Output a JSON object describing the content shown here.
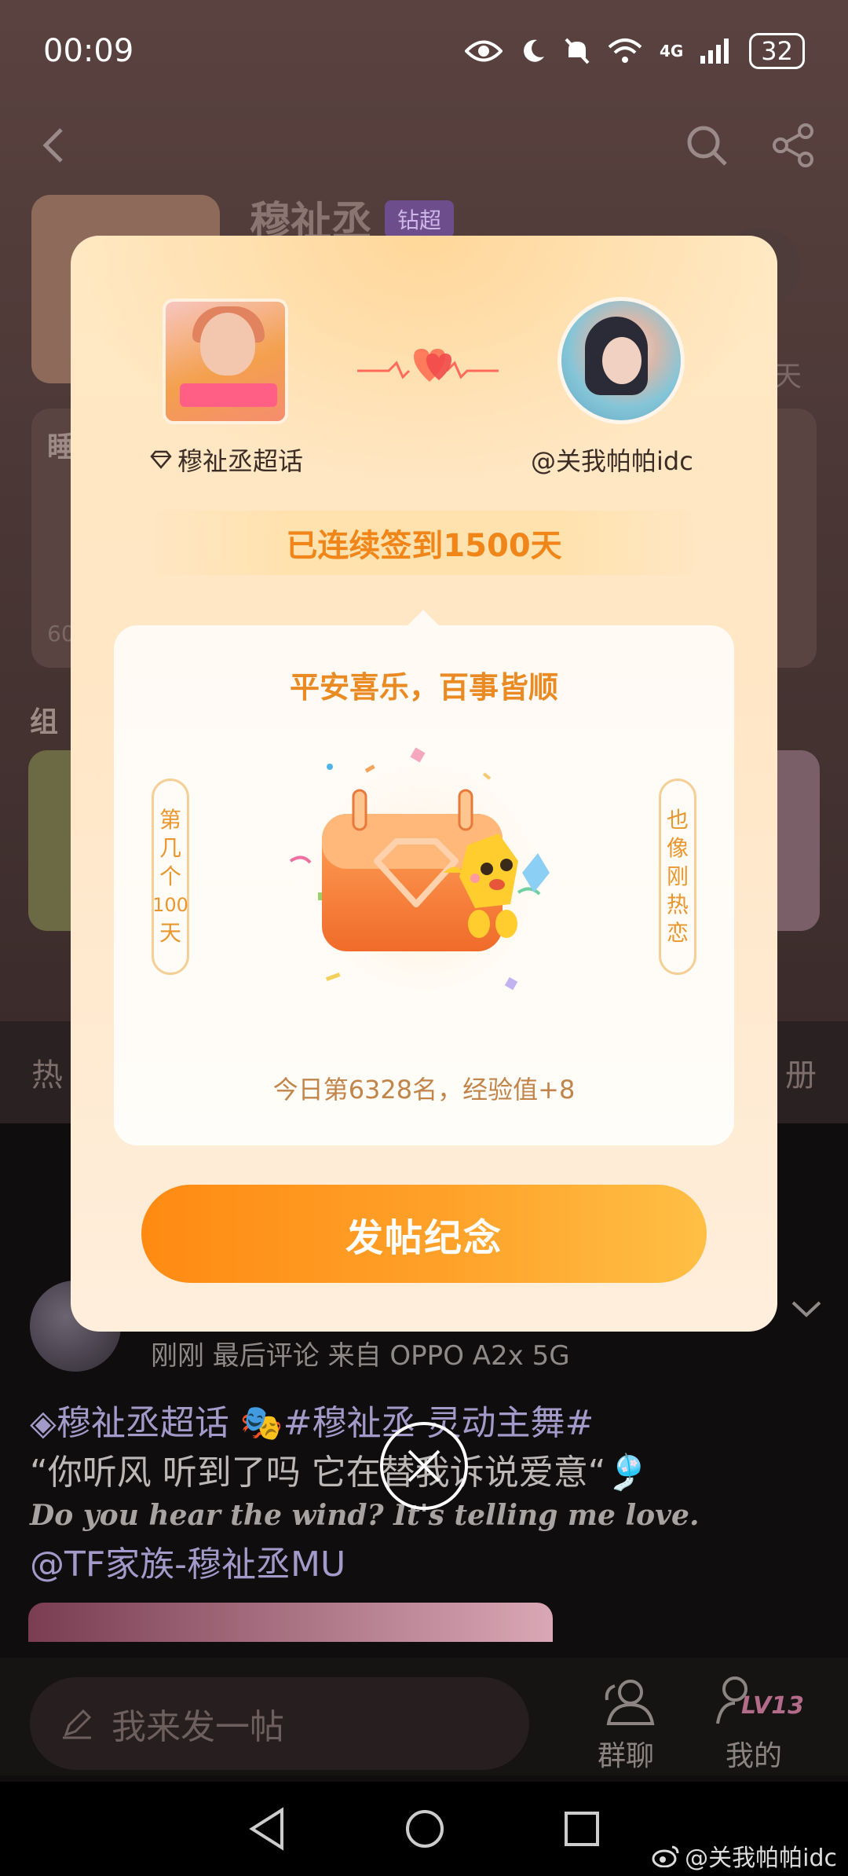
{
  "status_bar": {
    "time": "00:09",
    "network": "4G",
    "battery": "32"
  },
  "background": {
    "title": "穆祉丞",
    "badge": "钻超",
    "tabs": {
      "left": "热",
      "right": "册"
    },
    "side_left_1": "睡",
    "side_left_2": "组",
    "side_right": "天",
    "side_count": "60"
  },
  "dialog": {
    "supertopic_name": "穆祉丞超话",
    "user_name": "@关我帕帕idc",
    "streak_text": "已连续签到1500天",
    "wish_text": "平安喜乐，百事皆顺",
    "left_scroll": [
      "第",
      "几",
      "个",
      "100",
      "天"
    ],
    "right_scroll": [
      "也",
      "像",
      "刚",
      "热",
      "恋"
    ],
    "rank_text": "今日第6328名，经验值+8",
    "post_button_label": "发帖纪念"
  },
  "post": {
    "meta": "刚刚 最后评论  来自 OPPO A2x 5G",
    "line1": "◈穆祉丞超话 🎭#穆祉丞 灵动主舞#",
    "line2": "“你听风 听到了吗 它在替我诉说爱意“🎐",
    "line3": "Do you hear the wind? It's telling me love.",
    "line4": "@TF家族-穆祉丞MU"
  },
  "bottom_bar": {
    "compose_placeholder": "我来发一帖",
    "group_chat": "群聊",
    "mine": "我的",
    "level": "LV13"
  },
  "watermark": "@关我帕帕idc",
  "colors": {
    "accent_orange": "#f0861a",
    "button_gradient_start": "#ff8a12",
    "button_gradient_end": "#ffbf45"
  },
  "icons": [
    "back-icon",
    "search-icon",
    "share-icon",
    "diamond-icon",
    "heart-icon",
    "close-icon",
    "edit-icon",
    "group-chat-icon",
    "profile-icon",
    "nav-back-icon",
    "nav-home-icon",
    "nav-recents-icon",
    "weibo-icon"
  ]
}
